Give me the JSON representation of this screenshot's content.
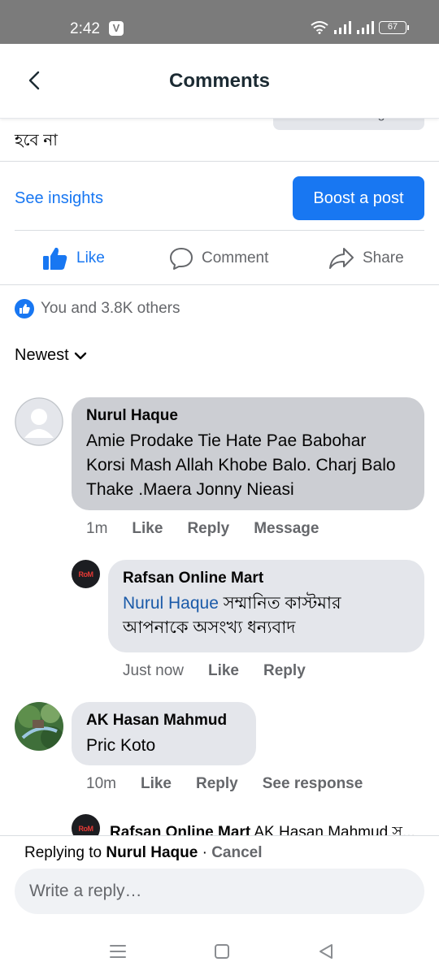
{
  "status_bar": {
    "time": "2:42",
    "app_badge": "V",
    "battery": "67"
  },
  "header": {
    "title": "Comments"
  },
  "post": {
    "text_tail": "হবে না",
    "send_message_label": "Send Message"
  },
  "insights": {
    "see_insights": "See insights",
    "boost": "Boost a post"
  },
  "actions": {
    "like": "Like",
    "comment": "Comment",
    "share": "Share"
  },
  "reactions": {
    "summary": "You and 3.8K others"
  },
  "sort": {
    "label": "Newest"
  },
  "comments": [
    {
      "author": "Nurul Haque",
      "text": "Amie Prodake Tie Hate Pae Babohar Korsi Mash Allah Khobe Balo. Charj Balo Thake .Maera Jonny Nieasi",
      "time": "1m",
      "like": "Like",
      "reply": "Reply",
      "extra": "Message"
    },
    {
      "author": "Rafsan Online Mart",
      "mention": "Nurul Haque",
      "text": " সম্মানিত কাস্টমার আপনাকে অসংখ্য ধন্যবাদ",
      "time": "Just now",
      "like": "Like",
      "reply": "Reply",
      "logo_text": "RoM"
    },
    {
      "author": "AK Hasan Mahmud",
      "text": "Pric Koto",
      "time": "10m",
      "like": "Like",
      "reply": "Reply",
      "extra": "See response"
    }
  ],
  "peek_reply": {
    "author": "Rafsan Online Mart",
    "text": " AK Hasan Mahmud স...",
    "logo_text": "RoM"
  },
  "reply_bar": {
    "replying_prefix": "Replying to ",
    "replying_name": "Nurul Haque",
    "separator": " · ",
    "cancel": "Cancel",
    "placeholder": "Write a reply…"
  },
  "colors": {
    "accent": "#1877f2",
    "bubble": "#e4e6eb",
    "status_bar": "#7b7b7b"
  }
}
